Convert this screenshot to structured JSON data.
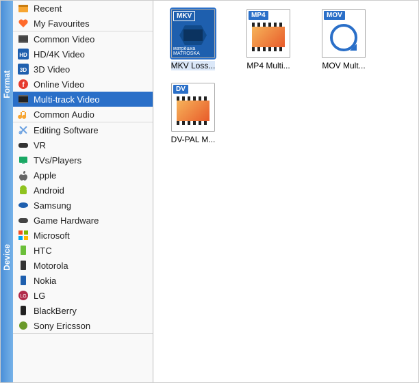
{
  "rail": {
    "format_label": "Format",
    "device_label": "Device"
  },
  "sidebar": {
    "groups": [
      {
        "id": "pinned",
        "items": [
          {
            "icon": "recent",
            "label": "Recent"
          },
          {
            "icon": "heart",
            "label": "My Favourites"
          }
        ]
      },
      {
        "id": "format",
        "items": [
          {
            "icon": "film",
            "label": "Common Video"
          },
          {
            "icon": "hd",
            "label": "HD/4K Video"
          },
          {
            "icon": "3d",
            "label": "3D Video"
          },
          {
            "icon": "online",
            "label": "Online Video"
          },
          {
            "icon": "multi",
            "label": "Multi-track Video",
            "selected": true
          },
          {
            "icon": "audio",
            "label": "Common Audio"
          }
        ]
      },
      {
        "id": "device",
        "items": [
          {
            "icon": "scissors",
            "label": "Editing Software"
          },
          {
            "icon": "vr",
            "label": "VR"
          },
          {
            "icon": "tv",
            "label": "TVs/Players"
          },
          {
            "icon": "apple",
            "label": "Apple"
          },
          {
            "icon": "android",
            "label": "Android"
          },
          {
            "icon": "samsung",
            "label": "Samsung"
          },
          {
            "icon": "game",
            "label": "Game Hardware"
          },
          {
            "icon": "ms",
            "label": "Microsoft"
          },
          {
            "icon": "htc",
            "label": "HTC"
          },
          {
            "icon": "moto",
            "label": "Motorola"
          },
          {
            "icon": "nokia",
            "label": "Nokia"
          },
          {
            "icon": "lg",
            "label": "LG"
          },
          {
            "icon": "bb",
            "label": "BlackBerry"
          },
          {
            "icon": "sony",
            "label": "Sony Ericsson"
          }
        ]
      }
    ]
  },
  "files": [
    {
      "badge": "MKV",
      "kind": "mkv",
      "label": "MKV Loss...",
      "selected": true
    },
    {
      "badge": "MP4",
      "kind": "film",
      "label": "MP4 Multi..."
    },
    {
      "badge": "MOV",
      "kind": "qt",
      "label": "MOV Mult..."
    },
    {
      "badge": "DV",
      "kind": "film",
      "label": "DV-PAL M..."
    }
  ]
}
